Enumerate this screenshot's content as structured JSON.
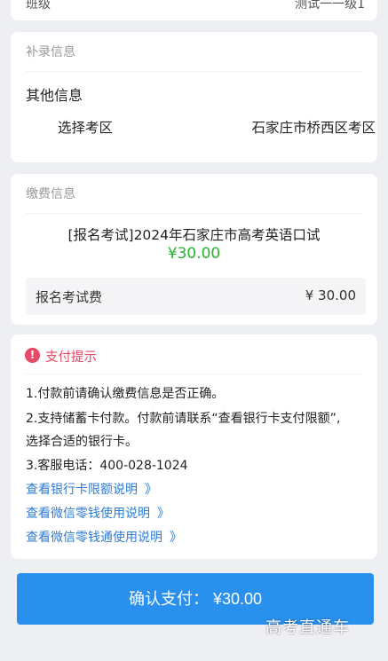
{
  "top_partial": {
    "left_text": "班级",
    "right_text": "测试一一级1"
  },
  "supplement": {
    "section_title": "补录信息",
    "other_heading": "其他信息",
    "exam_area_label": "选择考区",
    "exam_area_value": "石家庄市桥西区考区"
  },
  "payment": {
    "section_title": "缴费信息",
    "item_title": "[报名考试]2024年石家庄市高考英语口试",
    "item_amount": "¥30.00",
    "fee_label": "报名考试费",
    "fee_value": "¥ 30.00",
    "amount_color": "#27b531"
  },
  "tips": {
    "title": "支付提示",
    "icon": "exclamation-circle-icon",
    "lines": [
      "1.付款前请确认缴费信息是否正确。",
      "2.支持储蓄卡付款。付款前请联系“查看银行卡支付限额”,",
      "选择合适的银行卡。",
      "3.客服电话：400-028-1024"
    ],
    "links": [
      {
        "label": "查看银行卡限额说明",
        "chevron": "》"
      },
      {
        "label": "查看微信零钱使用说明",
        "chevron": "》"
      },
      {
        "label": "查看微信零钱通使用说明",
        "chevron": "》"
      }
    ],
    "accent_color": "#e94866",
    "link_color": "#2f7bd6"
  },
  "confirm": {
    "label": "确认支付： ¥30.00",
    "color": "#2990ee"
  },
  "watermark": "高考直通车"
}
